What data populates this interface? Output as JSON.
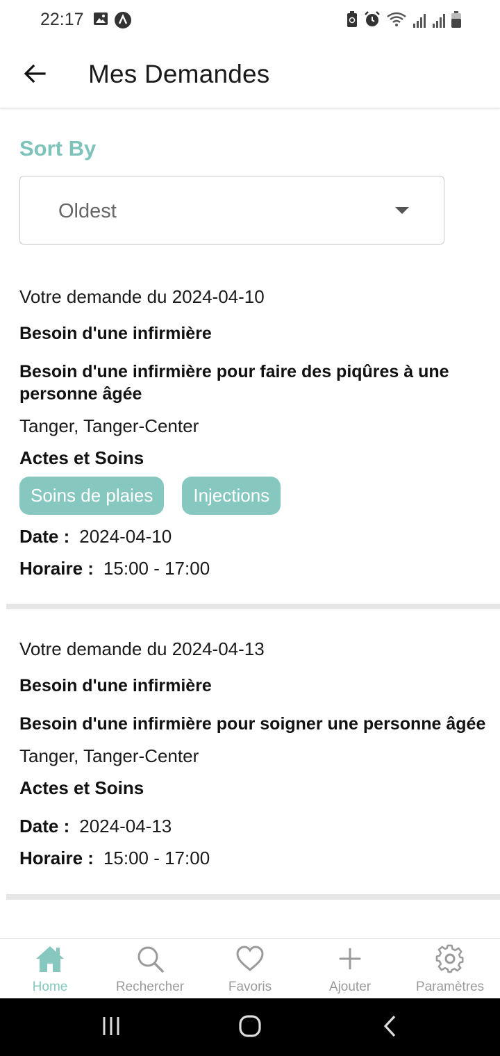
{
  "status": {
    "time": "22:17"
  },
  "header": {
    "title": "Mes Demandes"
  },
  "sort": {
    "label": "Sort By",
    "selected": "Oldest"
  },
  "requests": [
    {
      "submitted": "Votre demande du 2024-04-10",
      "title": "Besoin d'une infirmière",
      "description": "Besoin d'une infirmière pour faire des piqûres à une personne âgée",
      "location": "Tanger, Tanger-Center",
      "section": "Actes et Soins",
      "tags": [
        "Soins de plaies",
        "Injections"
      ],
      "date_label": "Date :",
      "date": "2024-04-10",
      "time_label": "Horaire :",
      "time": "15:00 - 17:00"
    },
    {
      "submitted": "Votre demande du 2024-04-13",
      "title": "Besoin d'une infirmière",
      "description": "Besoin d'une infirmière pour soigner une personne âgée",
      "location": "Tanger, Tanger-Center",
      "section": "Actes et Soins",
      "tags": [],
      "date_label": "Date :",
      "date": "2024-04-13",
      "time_label": "Horaire :",
      "time": "15:00 - 17:00"
    }
  ],
  "bottom_nav": [
    {
      "label": "Home",
      "icon": "home-icon",
      "active": true
    },
    {
      "label": "Rechercher",
      "icon": "search-icon",
      "active": false
    },
    {
      "label": "Favoris",
      "icon": "heart-icon",
      "active": false
    },
    {
      "label": "Ajouter",
      "icon": "plus-icon",
      "active": false
    },
    {
      "label": "Paramètres",
      "icon": "gear-icon",
      "active": false
    }
  ],
  "colors": {
    "accent": "#86c8bf",
    "sort_label": "#7dc3b9",
    "inactive": "#9a9a9a"
  }
}
